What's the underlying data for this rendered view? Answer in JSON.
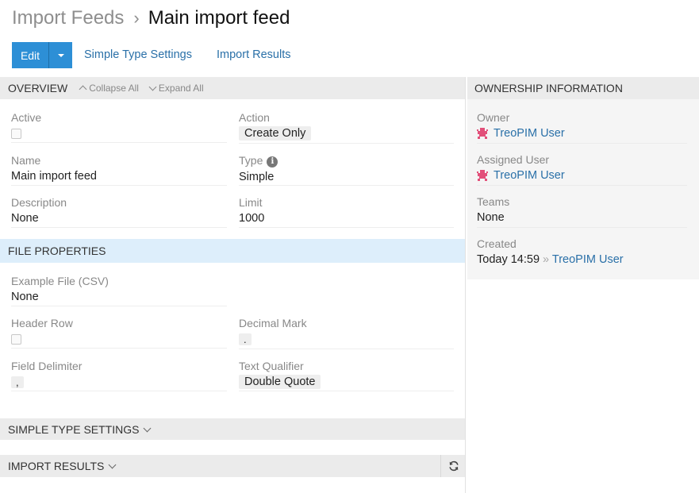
{
  "breadcrumb": {
    "parent": "Import Feeds",
    "separator": "›",
    "current": "Main import feed"
  },
  "toolbar": {
    "edit_label": "Edit",
    "links": [
      "Simple Type Settings",
      "Import Results"
    ]
  },
  "overview": {
    "title": "OVERVIEW",
    "collapse_all": "Collapse All",
    "expand_all": "Expand All",
    "fields": {
      "active": {
        "label": "Active",
        "checked": false
      },
      "action": {
        "label": "Action",
        "value": "Create Only"
      },
      "name": {
        "label": "Name",
        "value": "Main import feed"
      },
      "type": {
        "label": "Type",
        "value": "Simple",
        "info_icon": "info-icon"
      },
      "description": {
        "label": "Description",
        "value": "None"
      },
      "limit": {
        "label": "Limit",
        "value": "1000"
      }
    }
  },
  "file_properties": {
    "title": "FILE PROPERTIES",
    "fields": {
      "example_file": {
        "label": "Example File (CSV)",
        "value": "None"
      },
      "header_row": {
        "label": "Header Row",
        "checked": false
      },
      "decimal_mark": {
        "label": "Decimal Mark",
        "value": "."
      },
      "field_delimiter": {
        "label": "Field Delimiter",
        "value": ","
      },
      "text_qualifier": {
        "label": "Text Qualifier",
        "value": "Double Quote"
      }
    }
  },
  "panels": {
    "simple_type_settings": "SIMPLE TYPE SETTINGS",
    "import_results": "IMPORT RESULTS"
  },
  "ownership": {
    "title": "OWNERSHIP INFORMATION",
    "owner": {
      "label": "Owner",
      "value": "TreoPIM User"
    },
    "assigned_user": {
      "label": "Assigned User",
      "value": "TreoPIM User"
    },
    "teams": {
      "label": "Teams",
      "value": "None"
    },
    "created": {
      "label": "Created",
      "time": "Today 14:59",
      "separator": "»",
      "user": "TreoPIM User"
    }
  },
  "colors": {
    "primary": "#2d8fd6",
    "link": "#2a70a8",
    "panel_header": "#ebebeb",
    "section_highlight": "#ddeefb",
    "avatar": "#e2507a"
  },
  "icons": {
    "caret": "caret-down-icon",
    "refresh": "refresh-icon",
    "avatar": "user-avatar-icon"
  }
}
